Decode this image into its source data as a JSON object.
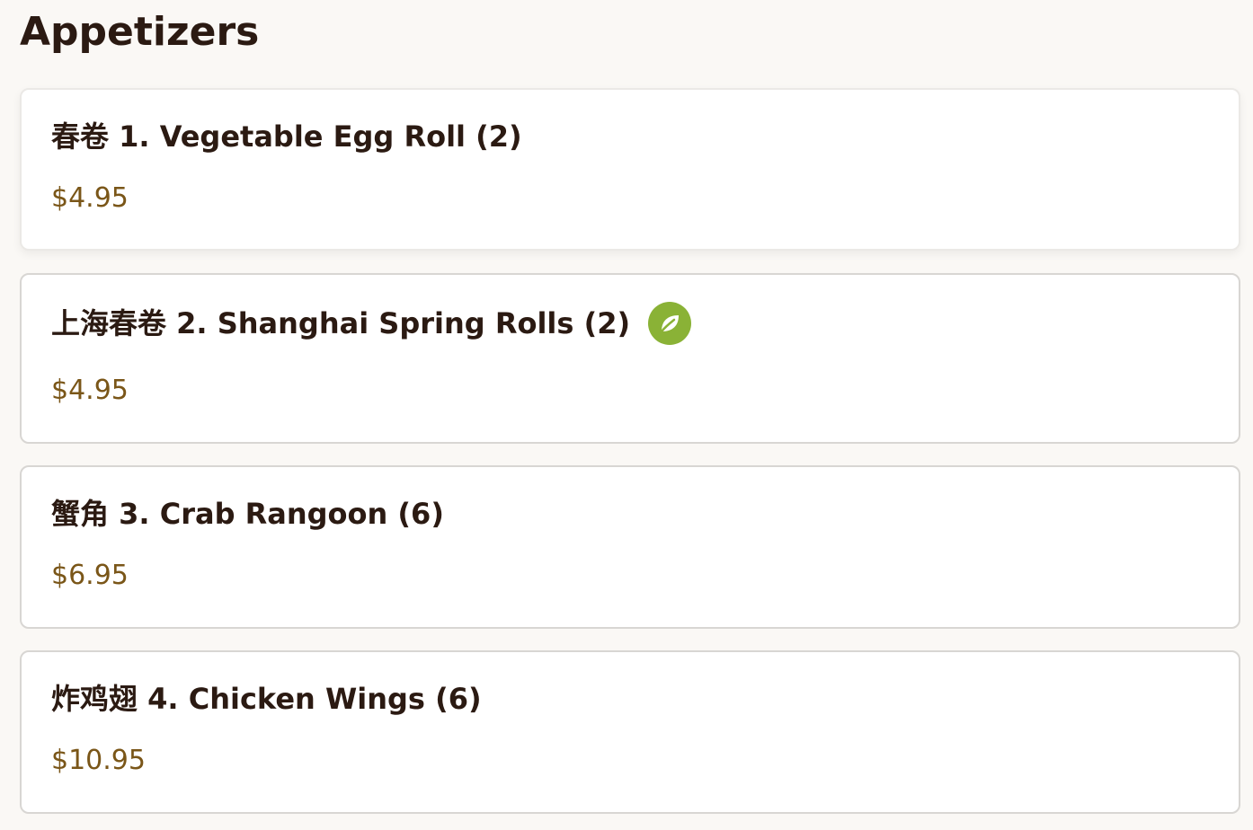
{
  "section": {
    "title": "Appetizers"
  },
  "items": [
    {
      "name": "春卷 1. Vegetable Egg Roll (2)",
      "price": "$4.95",
      "vegetarian": false
    },
    {
      "name": "上海春卷 2. Shanghai Spring Rolls (2)",
      "price": "$4.95",
      "vegetarian": true,
      "badge_icon": "leaf-icon"
    },
    {
      "name": "蟹角 3. Crab Rangoon (6)",
      "price": "$6.95",
      "vegetarian": false
    },
    {
      "name": "炸鸡翅 4. Chicken Wings (6)",
      "price": "$10.95",
      "vegetarian": false
    }
  ],
  "colors": {
    "title": "#2b1a12",
    "price": "#7a5618",
    "veg_badge": "#8ab236",
    "background": "#faf8f5",
    "card_border": "#d8d6d3"
  }
}
